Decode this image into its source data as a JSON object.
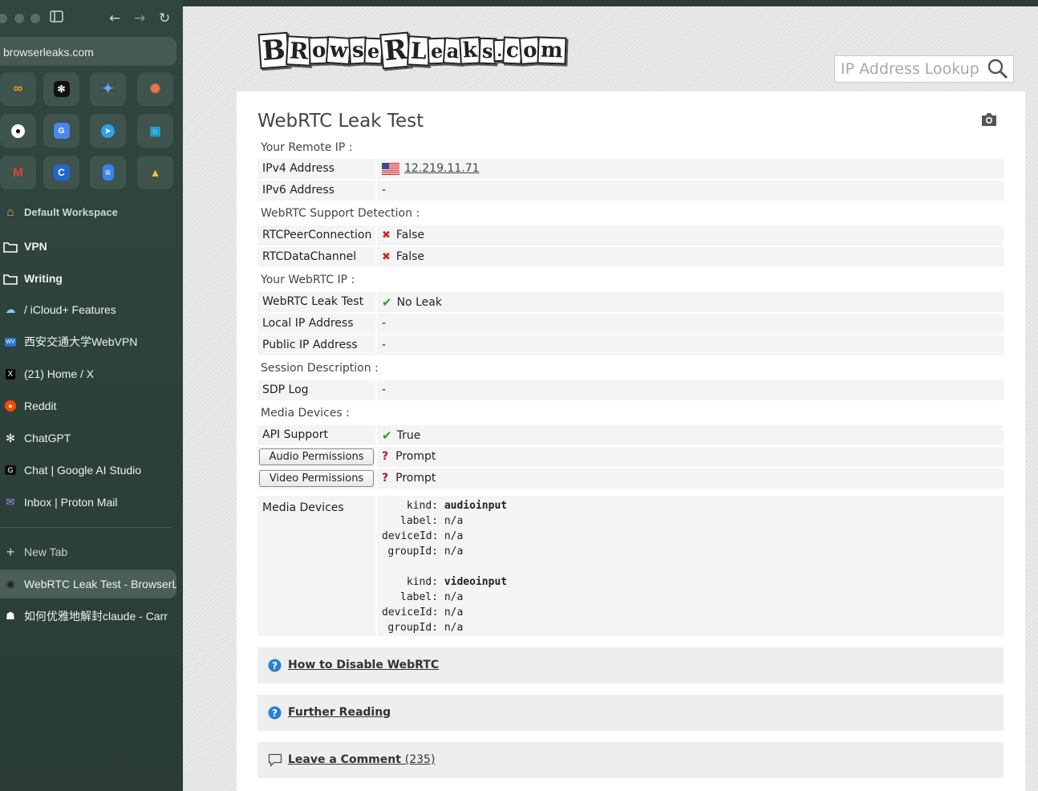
{
  "sidebar": {
    "url": "browserleaks.com",
    "workspace": "Default Workspace",
    "folders": [
      {
        "label": "VPN"
      },
      {
        "label": "Writing"
      }
    ],
    "tabs": [
      {
        "label": "/ iCloud+ Features"
      },
      {
        "label": "西安交通大学WebVPN"
      },
      {
        "label": "(21) Home / X"
      },
      {
        "label": "Reddit"
      },
      {
        "label": "ChatGPT"
      },
      {
        "label": "Chat | Google AI Studio"
      },
      {
        "label": "Inbox | Proton Mail"
      }
    ],
    "new_tab": "New Tab",
    "open_tabs": [
      {
        "label": "WebRTC Leak Test - BrowserLeaks"
      },
      {
        "label": "如何优雅地解封claude - Carr"
      }
    ]
  },
  "header": {
    "logo_text": "BrowseRLeaks.com",
    "lookup_placeholder": "IP Address Lookup"
  },
  "page": {
    "title": "WebRTC Leak Test",
    "sections": {
      "remote_ip": "Your Remote IP :",
      "support": "WebRTC Support Detection :",
      "webrtc_ip": "Your WebRTC IP :",
      "session": "Session Description :",
      "media": "Media Devices :"
    },
    "rows": {
      "ipv4": {
        "key": "IPv4 Address",
        "value": "12.219.11.71"
      },
      "ipv6": {
        "key": "IPv6 Address",
        "value": "-"
      },
      "peer": {
        "key": "RTCPeerConnection",
        "value": "False"
      },
      "datach": {
        "key": "RTCDataChannel",
        "value": "False"
      },
      "leak": {
        "key": "WebRTC Leak Test",
        "value": "No Leak"
      },
      "local": {
        "key": "Local IP Address",
        "value": "-"
      },
      "public": {
        "key": "Public IP Address",
        "value": "-"
      },
      "sdp": {
        "key": "SDP Log",
        "value": "-"
      },
      "api": {
        "key": "API Support",
        "value": "True"
      },
      "audio": {
        "key": "Audio Permissions",
        "value": "Prompt"
      },
      "video": {
        "key": "Video Permissions",
        "value": "Prompt"
      }
    },
    "media_devices": {
      "key": "Media Devices",
      "labels": {
        "kind": "kind:",
        "label": "label:",
        "deviceId": "deviceId:",
        "groupId": "groupId:"
      },
      "devices": [
        {
          "kind": "audioinput",
          "label": "n/a",
          "deviceId": "n/a",
          "groupId": "n/a"
        },
        {
          "kind": "videoinput",
          "label": "n/a",
          "deviceId": "n/a",
          "groupId": "n/a"
        }
      ]
    },
    "panels": [
      {
        "label": "How to Disable WebRTC"
      },
      {
        "label": "Further Reading"
      },
      {
        "label": "Leave a Comment",
        "count": "(235)"
      }
    ]
  },
  "colors": {
    "sidebar_bg": "#2c4039",
    "fail": "#d2232a",
    "ok": "#2d9a2d",
    "prompt": "#c0151c",
    "help_icon": "#2a7fd4"
  }
}
